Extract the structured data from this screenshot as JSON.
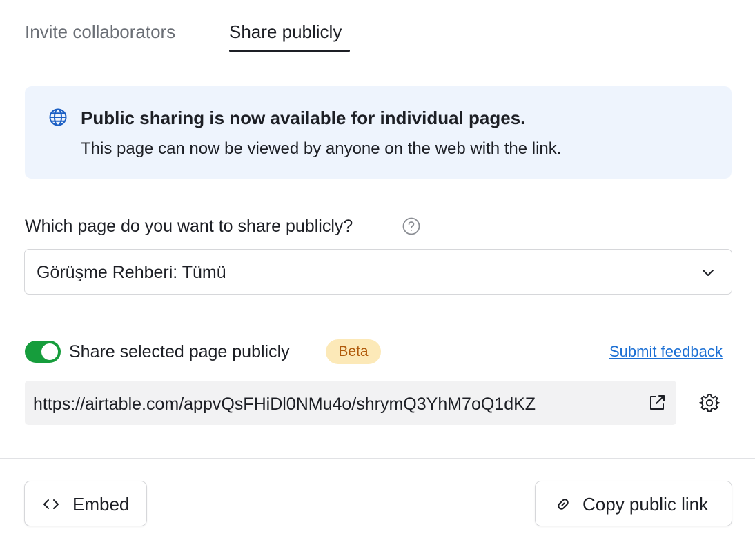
{
  "tabs": {
    "invite_label": "Invite collaborators",
    "share_label": "Share publicly",
    "active": "share"
  },
  "banner": {
    "icon": "globe-icon",
    "title": "Public sharing is now available for individual pages.",
    "body": "This page can now be viewed by anyone on the web with the link."
  },
  "page_select": {
    "question": "Which page do you want to share publicly?",
    "help_icon": "help-circle-icon",
    "selected": "Görüşme Rehberi: Tümü",
    "chevron_icon": "chevron-down-icon"
  },
  "share_toggle": {
    "label": "Share selected page publicly",
    "enabled": true,
    "badge": "Beta",
    "feedback_link": "Submit feedback"
  },
  "public_url": {
    "value": "https://airtable.com/appvQsFHiDl0NMu4o/shrymQ3YhM7oQ1dKZ",
    "open_icon": "external-link-icon",
    "settings_icon": "gear-icon"
  },
  "footer": {
    "embed_label": "Embed",
    "embed_icon": "code-icon",
    "copy_label": "Copy public link",
    "copy_icon": "link-icon"
  },
  "colors": {
    "toggle_on": "#169d3c",
    "banner_bg": "#eef4fd",
    "badge_bg": "#fce9b8",
    "badge_text": "#b05a0b",
    "link": "#1b6fd4"
  }
}
